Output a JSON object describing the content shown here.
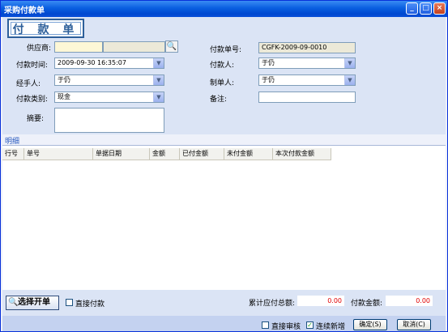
{
  "window": {
    "title": "采购付款单",
    "min_glyph": "_",
    "max_glyph": "□",
    "close_glyph": "×"
  },
  "logo_text": "付 款 单",
  "form": {
    "supplier_label": "供应商:",
    "supplier_value": "",
    "payment_no_label": "付款单号:",
    "payment_no_value": "CGFK-2009-09-0010",
    "payment_time_label": "付款时间:",
    "payment_time_value": "2009-09-30 16:35:07",
    "payer_label": "付款人:",
    "payer_value": "于仍",
    "handler_label": "经手人:",
    "handler_value": "于仍",
    "maker_label": "制单人:",
    "maker_value": "于仍",
    "payment_type_label": "付款类别:",
    "payment_type_value": "现金",
    "remark_label": "备注:",
    "remark_value": "",
    "summary_label": "摘要:",
    "summary_value": ""
  },
  "detail_section_label": "明细",
  "grid": {
    "columns": [
      "行号",
      "单号",
      "单据日期",
      "金额",
      "已付金额",
      "未付金额",
      "本次付款金额"
    ]
  },
  "bottom": {
    "select_bill_button": "选择开单",
    "direct_payment_label": "直接付款",
    "direct_payment_checked": false,
    "total_payable_label": "累计应付总额:",
    "total_payable_value": "0.00",
    "payment_amount_label": "付款金额:",
    "payment_amount_value": "0.00"
  },
  "footer": {
    "direct_audit_label": "直接审核",
    "direct_audit_checked": false,
    "continue_new_label": "连续新增",
    "continue_new_checked": true,
    "confirm_button": "确定(S)",
    "cancel_button": "取消(C)"
  },
  "colors": {
    "titlebar": "#0a5fe0",
    "amount_text": "#e00000",
    "header_bg": "#dbe4f5"
  }
}
